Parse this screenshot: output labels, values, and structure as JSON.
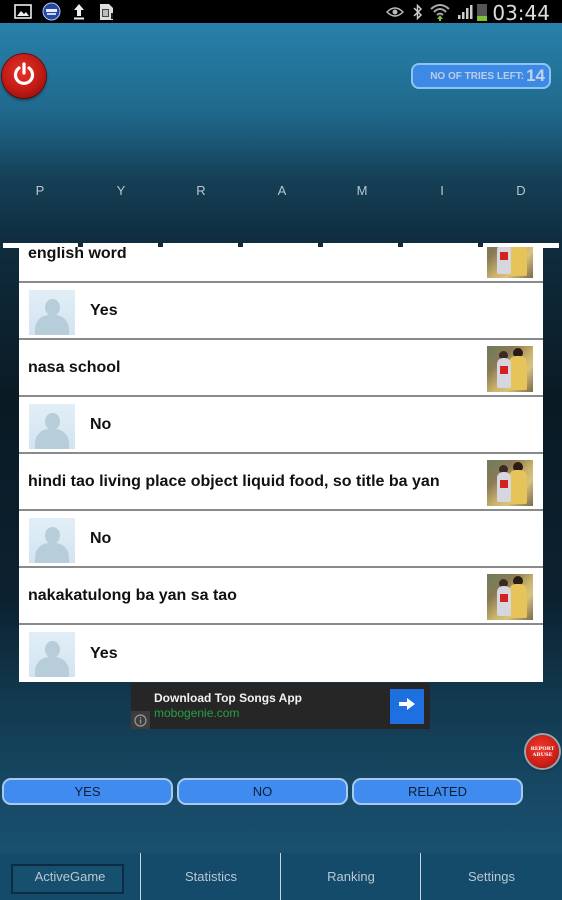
{
  "status_bar": {
    "left_icons": [
      "gallery-icon",
      "app-badge-icon",
      "upload-icon",
      "sd-card-icon"
    ],
    "right_icons": [
      "eye-icon",
      "bluetooth-icon",
      "wifi-icon",
      "signal-icon",
      "battery-icon"
    ],
    "time": "03:44"
  },
  "header": {
    "power_icon": "power-icon",
    "tries_label": "NO OF TRIES LEFT:",
    "tries_count": "14",
    "letters": [
      "P",
      "Y",
      "R",
      "A",
      "M",
      "I",
      "D"
    ]
  },
  "conversation": [
    {
      "type": "question",
      "text": "english word",
      "avatar": "user-photo"
    },
    {
      "type": "answer",
      "text": "Yes",
      "avatar": "default-avatar"
    },
    {
      "type": "question",
      "text": "nasa school",
      "avatar": "user-photo"
    },
    {
      "type": "answer",
      "text": "No",
      "avatar": "default-avatar"
    },
    {
      "type": "question",
      "text": "hindi tao living place object liquid food,  so title ba yan",
      "avatar": "user-photo"
    },
    {
      "type": "answer",
      "text": "No",
      "avatar": "default-avatar"
    },
    {
      "type": "question",
      "text": "nakakatulong  ba yan sa tao",
      "avatar": "user-photo"
    },
    {
      "type": "answer",
      "text": "Yes",
      "avatar": "default-avatar"
    }
  ],
  "ad": {
    "title": "Download Top Songs App",
    "url": "mobogenie.com",
    "info_icon": "info-icon",
    "go_icon": "arrow-right-icon"
  },
  "report": {
    "line1": "REPORT",
    "line2": "ABUSE"
  },
  "answer_buttons": {
    "yes": "YES",
    "no": "NO",
    "related": "RELATED"
  },
  "bottom_nav": {
    "items": [
      "ActiveGame",
      "Statistics",
      "Ranking",
      "Settings"
    ],
    "active": "ActiveGame"
  },
  "colors": {
    "button_blue": "#3f8bf0",
    "power_red": "#c01a14",
    "ad_green": "#25a244",
    "nav_bg": "#154b6a"
  }
}
